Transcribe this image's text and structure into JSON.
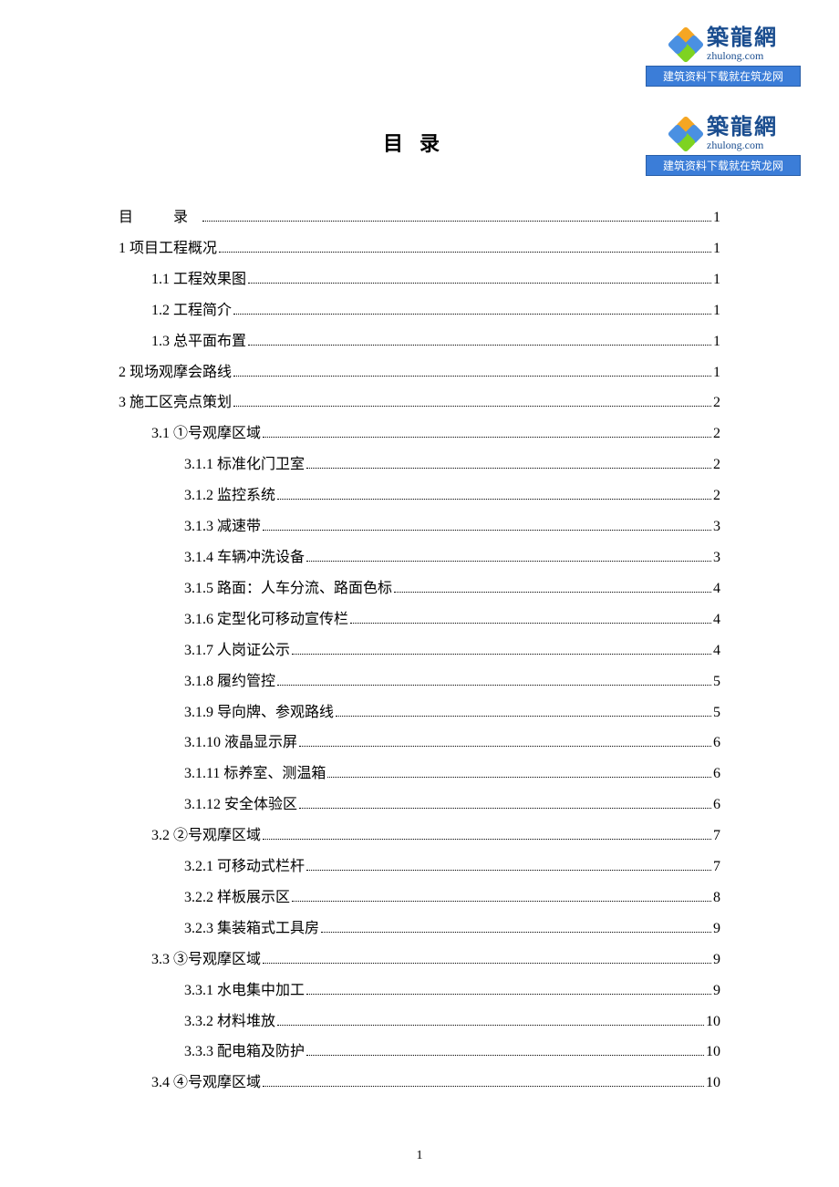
{
  "logo": {
    "cn": "築龍網",
    "en": "zhulong.com",
    "banner": "建筑资料下载就在筑龙网"
  },
  "title": "目录",
  "page_number": "1",
  "toc": [
    {
      "level": 0,
      "label": "目　录",
      "page": "1",
      "cls": "mulu-head"
    },
    {
      "level": 0,
      "label": "1  项目工程概况",
      "page": "1"
    },
    {
      "level": 1,
      "label": "1.1  工程效果图",
      "page": "1"
    },
    {
      "level": 1,
      "label": "1.2  工程简介",
      "page": "1"
    },
    {
      "level": 1,
      "label": "1.3  总平面布置",
      "page": "1"
    },
    {
      "level": 0,
      "label": "2  现场观摩会路线",
      "page": "1"
    },
    {
      "level": 0,
      "label": "3  施工区亮点策划",
      "page": "2"
    },
    {
      "level": 1,
      "label": "3.1  ①号观摩区域",
      "page": "2"
    },
    {
      "level": 2,
      "label": "3.1.1  标准化门卫室",
      "page": "2"
    },
    {
      "level": 2,
      "label": "3.1.2  监控系统",
      "page": "2"
    },
    {
      "level": 2,
      "label": "3.1.3  减速带",
      "page": "3"
    },
    {
      "level": 2,
      "label": "3.1.4  车辆冲洗设备",
      "page": "3"
    },
    {
      "level": 2,
      "label": "3.1.5  路面：人车分流、路面色标",
      "page": "4"
    },
    {
      "level": 2,
      "label": "3.1.6  定型化可移动宣传栏",
      "page": "4"
    },
    {
      "level": 2,
      "label": "3.1.7  人岗证公示",
      "page": "4"
    },
    {
      "level": 2,
      "label": "3.1.8  履约管控",
      "page": "5"
    },
    {
      "level": 2,
      "label": "3.1.9  导向牌、参观路线",
      "page": "5"
    },
    {
      "level": 2,
      "label": "3.1.10  液晶显示屏",
      "page": "6"
    },
    {
      "level": 2,
      "label": "3.1.11  标养室、测温箱",
      "page": "6"
    },
    {
      "level": 2,
      "label": "3.1.12  安全体验区",
      "page": "6"
    },
    {
      "level": 1,
      "label": "3.2  ②号观摩区域",
      "page": "7"
    },
    {
      "level": 2,
      "label": "3.2.1  可移动式栏杆",
      "page": "7"
    },
    {
      "level": 2,
      "label": "3.2.2  样板展示区",
      "page": "8"
    },
    {
      "level": 2,
      "label": "3.2.3  集装箱式工具房",
      "page": "9"
    },
    {
      "level": 1,
      "label": "3.3  ③号观摩区域",
      "page": "9"
    },
    {
      "level": 2,
      "label": "3.3.1  水电集中加工",
      "page": "9"
    },
    {
      "level": 2,
      "label": "3.3.2  材料堆放",
      "page": "10"
    },
    {
      "level": 2,
      "label": "3.3.3  配电箱及防护",
      "page": "10"
    },
    {
      "level": 1,
      "label": "3.4  ④号观摩区域",
      "page": "10"
    }
  ]
}
